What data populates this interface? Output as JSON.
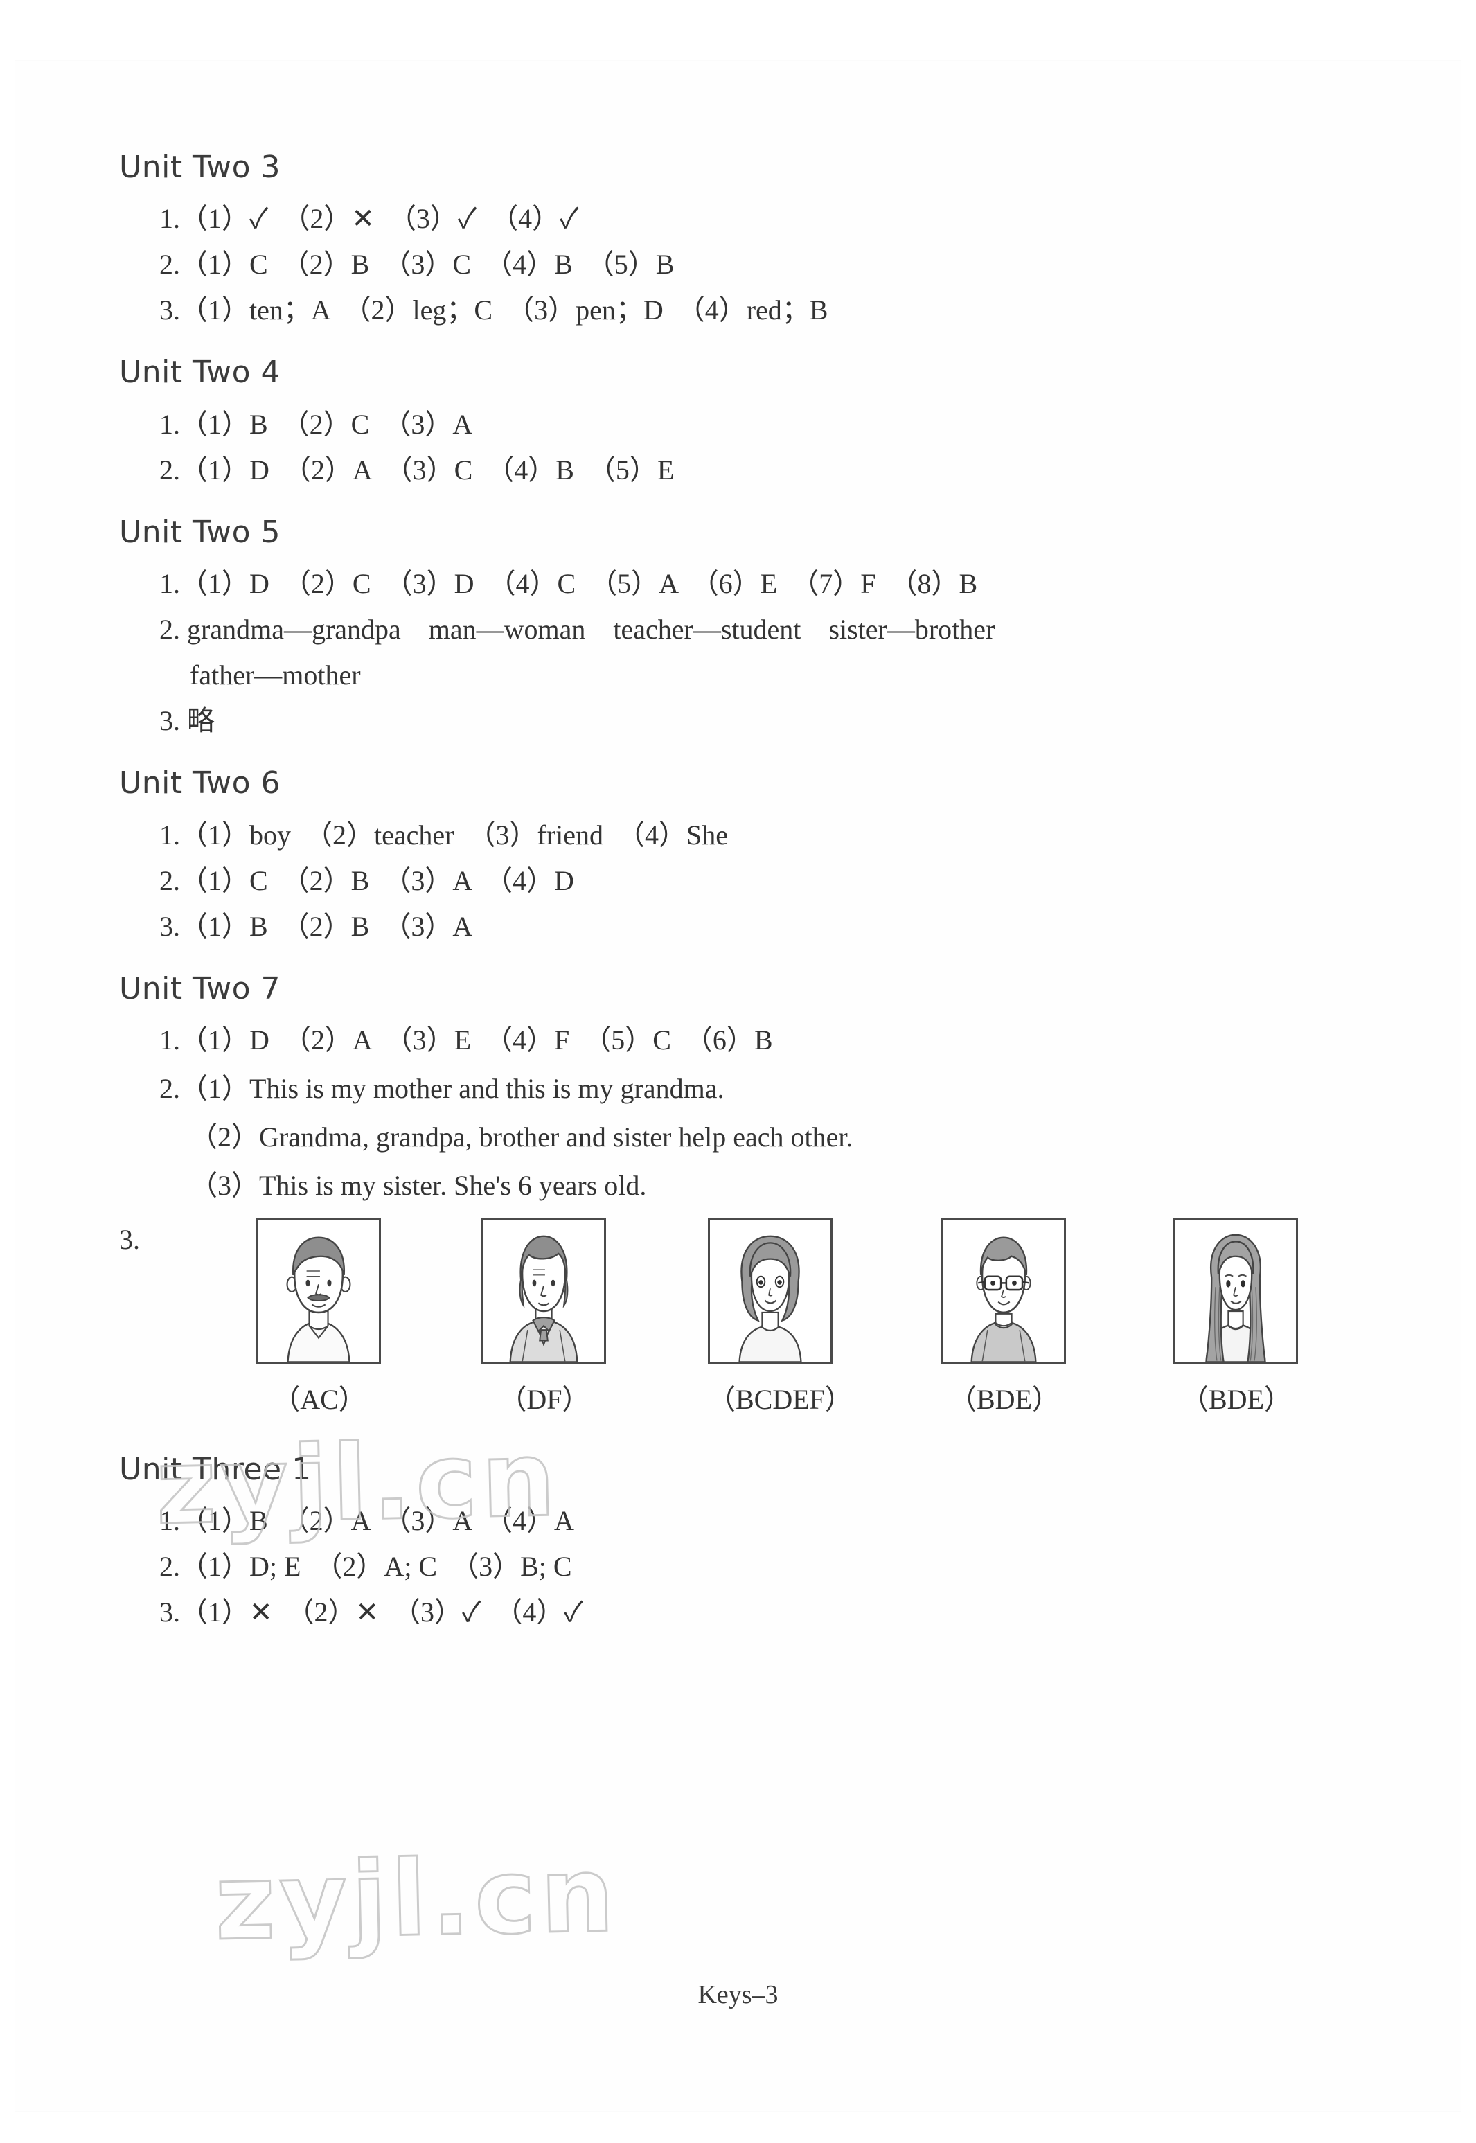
{
  "page": {
    "footer": "Keys–3",
    "watermark": "zyjl.cn"
  },
  "sections": [
    {
      "heading": "Unit Two 3",
      "lines": [
        "1.（1）✓　（2）✕　（3）✓　（4）✓",
        "2.（1）C　（2）B　（3）C　（4）B　（5）B",
        "3.（1）ten；A　（2）leg；C　（3）pen；D　（4）red；B"
      ]
    },
    {
      "heading": "Unit Two 4",
      "lines": [
        "1.（1）B　（2）C　（3）A",
        "2.（1）D　（2）A　（3）C　（4）B　（5）E"
      ]
    },
    {
      "heading": "Unit Two 5",
      "lines": [
        "1.（1）D　（2）C　（3）D　（4）C　（5）A　（6）E　（7）F　（8）B",
        "2. grandma—grandpa　man—woman　teacher—student　sister—brother",
        "father—mother",
        "3. 略"
      ]
    },
    {
      "heading": "Unit Two 6",
      "lines": [
        "1.（1）boy　（2）teacher　（3）friend　（4）She",
        "2.（1）C　（2）B　（3）A　（4）D",
        "3.（1）B　（2）B　（3）A"
      ]
    },
    {
      "heading": "Unit Two 7",
      "lines": [
        "1.（1）D　（2）A　（3）E　（4）F　（5）C　（6）B",
        "2.（1）This is my mother and this is my grandma.",
        "（2）Grandma, grandpa, brother and sister help each other.",
        "（3）This is my sister. She's 6 years old."
      ]
    },
    {
      "heading": "Unit Three 1",
      "lines": [
        "1.（1）B　（2）A　（3）A　（4）A",
        "2.（1）D; E　（2）A; C　（3）B; C",
        "3.（1）✕　（2）✕　（3）✓　（4）✓"
      ]
    }
  ],
  "picture_exercise": {
    "number": "3.",
    "items": [
      {
        "figure": "grandpa-with-mustache",
        "caption": "（AC）"
      },
      {
        "figure": "woman-with-scarf",
        "caption": "（DF）"
      },
      {
        "figure": "girl-with-bob-hair",
        "caption": "（BCDEF）"
      },
      {
        "figure": "boy-with-glasses",
        "caption": "（BDE）"
      },
      {
        "figure": "girl-with-long-hair",
        "caption": "（BDE）"
      }
    ]
  }
}
